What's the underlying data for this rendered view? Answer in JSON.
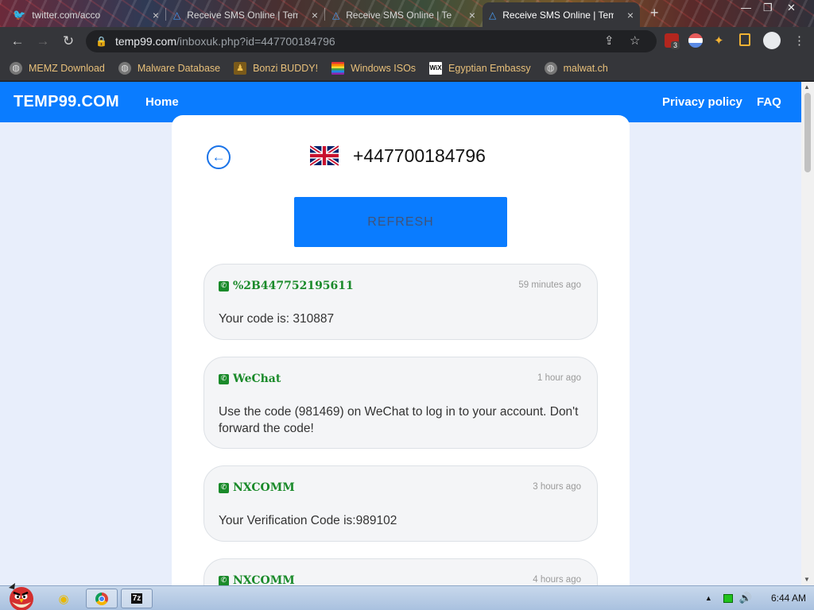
{
  "tabs": [
    {
      "title": "twitter.com/acco",
      "active": false
    },
    {
      "title": "Receive SMS Online | Tem",
      "active": false
    },
    {
      "title": "Receive SMS Online | Te",
      "active": false
    },
    {
      "title": "Receive SMS Online | Tem",
      "active": true
    }
  ],
  "address": {
    "host": "temp99.com",
    "path": "/inboxuk.php?id=447700184796"
  },
  "extension_badge": "3",
  "bookmarks": [
    "MEMZ Download",
    "Malware Database",
    "Bonzi BUDDY!",
    "Windows ISOs",
    "Egyptian Embassy",
    "malwat.ch"
  ],
  "site": {
    "brand": "TEMP99.COM",
    "nav_home": "Home",
    "nav_privacy": "Privacy policy",
    "nav_faq": "FAQ"
  },
  "inbox": {
    "phone_number": "+447700184796",
    "refresh_label": "REFRESH",
    "messages": [
      {
        "sender": "%2B447752195611",
        "time": "59 minutes ago",
        "body": "Your code is: 310887"
      },
      {
        "sender": "WeChat",
        "time": "1 hour ago",
        "body": "Use the code (981469) on WeChat to log in to your account. Don't forward the code!"
      },
      {
        "sender": "NXCOMM",
        "time": "3 hours ago",
        "body": "Your Verification Code is:989102"
      },
      {
        "sender": "NXCOMM",
        "time": "4 hours ago",
        "body": ""
      }
    ]
  },
  "taskbar": {
    "clock": "6:44 AM",
    "app_label": "7z"
  },
  "colors": {
    "brand_blue": "#0a7cff",
    "sender_green": "#1a8a2a",
    "page_bg": "#e8eefb"
  }
}
